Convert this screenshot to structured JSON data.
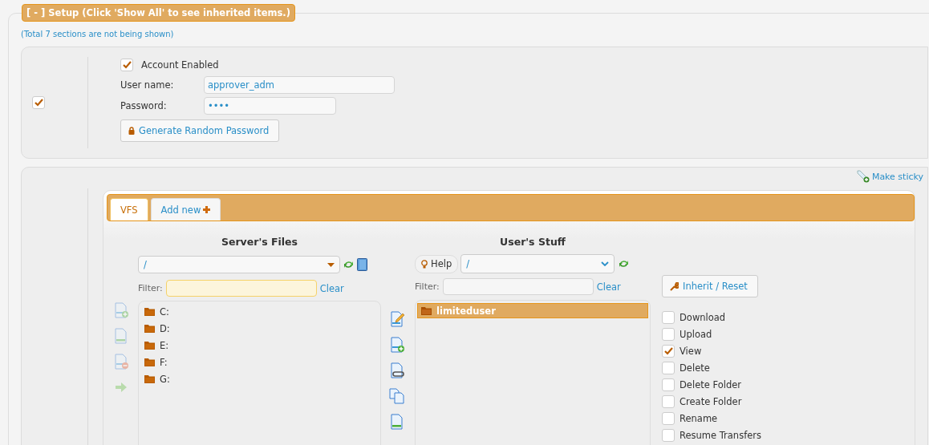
{
  "legend": {
    "label": "[ - ] Setup (Click 'Show All' to see inherited items.)",
    "expanded": true
  },
  "hidden_note": "(Total 7 sections are not being shown)",
  "account": {
    "row_checked": true,
    "enabled": {
      "label": "Account Enabled",
      "checked": true
    },
    "fields": [
      {
        "label": "User name:",
        "value": "approver_adm"
      },
      {
        "label": "Password:",
        "value": "••••"
      }
    ],
    "generate_button": "Generate Random Password"
  },
  "vfs": {
    "make_sticky": "Make sticky",
    "tabs": [
      {
        "label": "VFS",
        "selected": true,
        "kind": "plain"
      },
      {
        "label": "Add new",
        "selected": false,
        "kind": "add"
      }
    ],
    "server": {
      "title": "Server's Files",
      "path": "/",
      "filter_label": "Filter:",
      "clear": "Clear",
      "items": [
        {
          "label": "C:",
          "selected": false
        },
        {
          "label": "D:",
          "selected": false
        },
        {
          "label": "E:",
          "selected": false
        },
        {
          "label": "F:",
          "selected": false
        },
        {
          "label": "G:",
          "selected": false
        }
      ]
    },
    "server_tools": [
      {
        "kind": "add",
        "disabled": true
      },
      {
        "kind": "blank",
        "disabled": true
      },
      {
        "kind": "remove",
        "disabled": true
      },
      {
        "kind": "arrow",
        "disabled": true
      }
    ],
    "middle_tools": [
      {
        "kind": "edit",
        "disabled": false
      },
      {
        "kind": "add",
        "disabled": false
      },
      {
        "kind": "link",
        "disabled": false
      },
      {
        "kind": "copy",
        "disabled": false
      },
      {
        "kind": "blank",
        "disabled": false
      }
    ],
    "user": {
      "title": "User's Stuff",
      "help": "Help",
      "path": "/",
      "filter_label": "Filter:",
      "clear": "Clear",
      "items": [
        {
          "label": "limiteduser",
          "selected": true
        }
      ]
    },
    "inherit_button": "Inherit / Reset",
    "permissions": [
      {
        "label": "Download",
        "checked": false
      },
      {
        "label": "Upload",
        "checked": false
      },
      {
        "label": "View",
        "checked": true
      },
      {
        "label": "Delete",
        "checked": false
      },
      {
        "label": "Delete Folder",
        "checked": false
      },
      {
        "label": "Create Folder",
        "checked": false
      },
      {
        "label": "Rename",
        "checked": false
      },
      {
        "label": "Resume Transfers",
        "checked": false
      }
    ]
  }
}
